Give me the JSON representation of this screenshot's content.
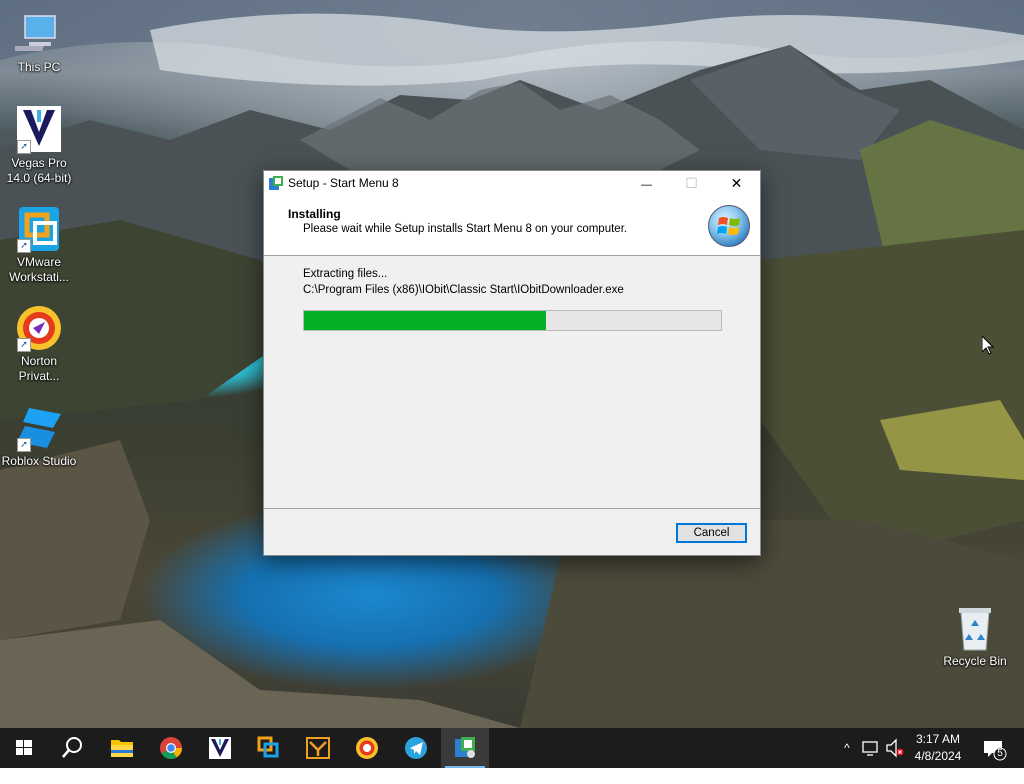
{
  "desktop": {
    "icons": [
      {
        "label": "This PC"
      },
      {
        "label": "Vegas Pro\n14.0 (64-bit)"
      },
      {
        "label": "VMware\nWorkstati..."
      },
      {
        "label": "Norton\nPrivat..."
      },
      {
        "label": "Roblox Studio"
      },
      {
        "label": "Recycle Bin"
      }
    ]
  },
  "dialog": {
    "title": "Setup - Start Menu 8",
    "minimize_glyph": "—",
    "maximize_glyph": "☐",
    "close_glyph": "✕",
    "header_title": "Installing",
    "header_subtitle": "Please wait while Setup installs Start Menu 8 on your computer.",
    "status_label": "Extracting files...",
    "status_path": "C:\\Program Files (x86)\\IObit\\Classic Start\\IObitDownloader.exe",
    "progress_fraction": 0.58,
    "cancel_label": "Cancel"
  },
  "taskbar": {
    "items": [
      "start-icon",
      "search-icon",
      "file-explorer-icon",
      "chrome-icon",
      "vegas-pro-icon",
      "vmware-icon",
      "app-icon",
      "norton-icon",
      "telegram-icon",
      "setup-icon"
    ],
    "active_item": "setup-icon",
    "tray": {
      "chevron": "^",
      "time": "3:17 AM",
      "date": "4/8/2024",
      "notification_count": "5"
    }
  },
  "colors": {
    "progress": "#06b025",
    "taskbar": "#1c1c1c",
    "accent": "#0078d7"
  }
}
